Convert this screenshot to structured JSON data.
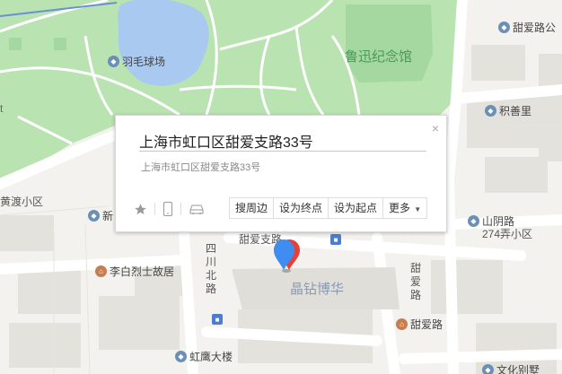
{
  "map": {
    "labels": {
      "badminton": "羽毛球场",
      "memorial": "鲁迅纪念馆",
      "tianai_gong": "甜爱路公",
      "jishanli": "积善里",
      "huangdu": "黄渡小区",
      "partial_left": "新",
      "shanyin": "山阴路",
      "shanyin_sub": "274弄小区",
      "tianaizhilu_top": "甜爱支路",
      "sichuan": "四川北路",
      "tianai_vert": "甜爱路",
      "libai": "李白烈士故居",
      "jingzuan": "晶钻博华",
      "tianai_road": "甜爱路",
      "hongying": "虹鹰大楼",
      "wenhua": "文化别墅",
      "edge_t": "t"
    }
  },
  "popup": {
    "title": "上海市虹口区甜爱支路33号",
    "address": "上海市虹口区甜爱支路33号",
    "close": "×",
    "actions": {
      "nearby": "搜周边",
      "set_end": "设为终点",
      "set_start": "设为起点",
      "more": "更多"
    }
  },
  "icons": {
    "star": "star-icon",
    "phone": "phone-icon",
    "car": "car-icon",
    "close": "close-icon",
    "caret": "caret-down-icon",
    "marker": "location-marker-icon"
  },
  "colors": {
    "park": "#b9e3b0",
    "water": "#a9c9f0",
    "road": "#ffffff",
    "block": "#e4e2dd",
    "marker_red": "#e5413b",
    "marker_blue": "#3f8df0"
  }
}
